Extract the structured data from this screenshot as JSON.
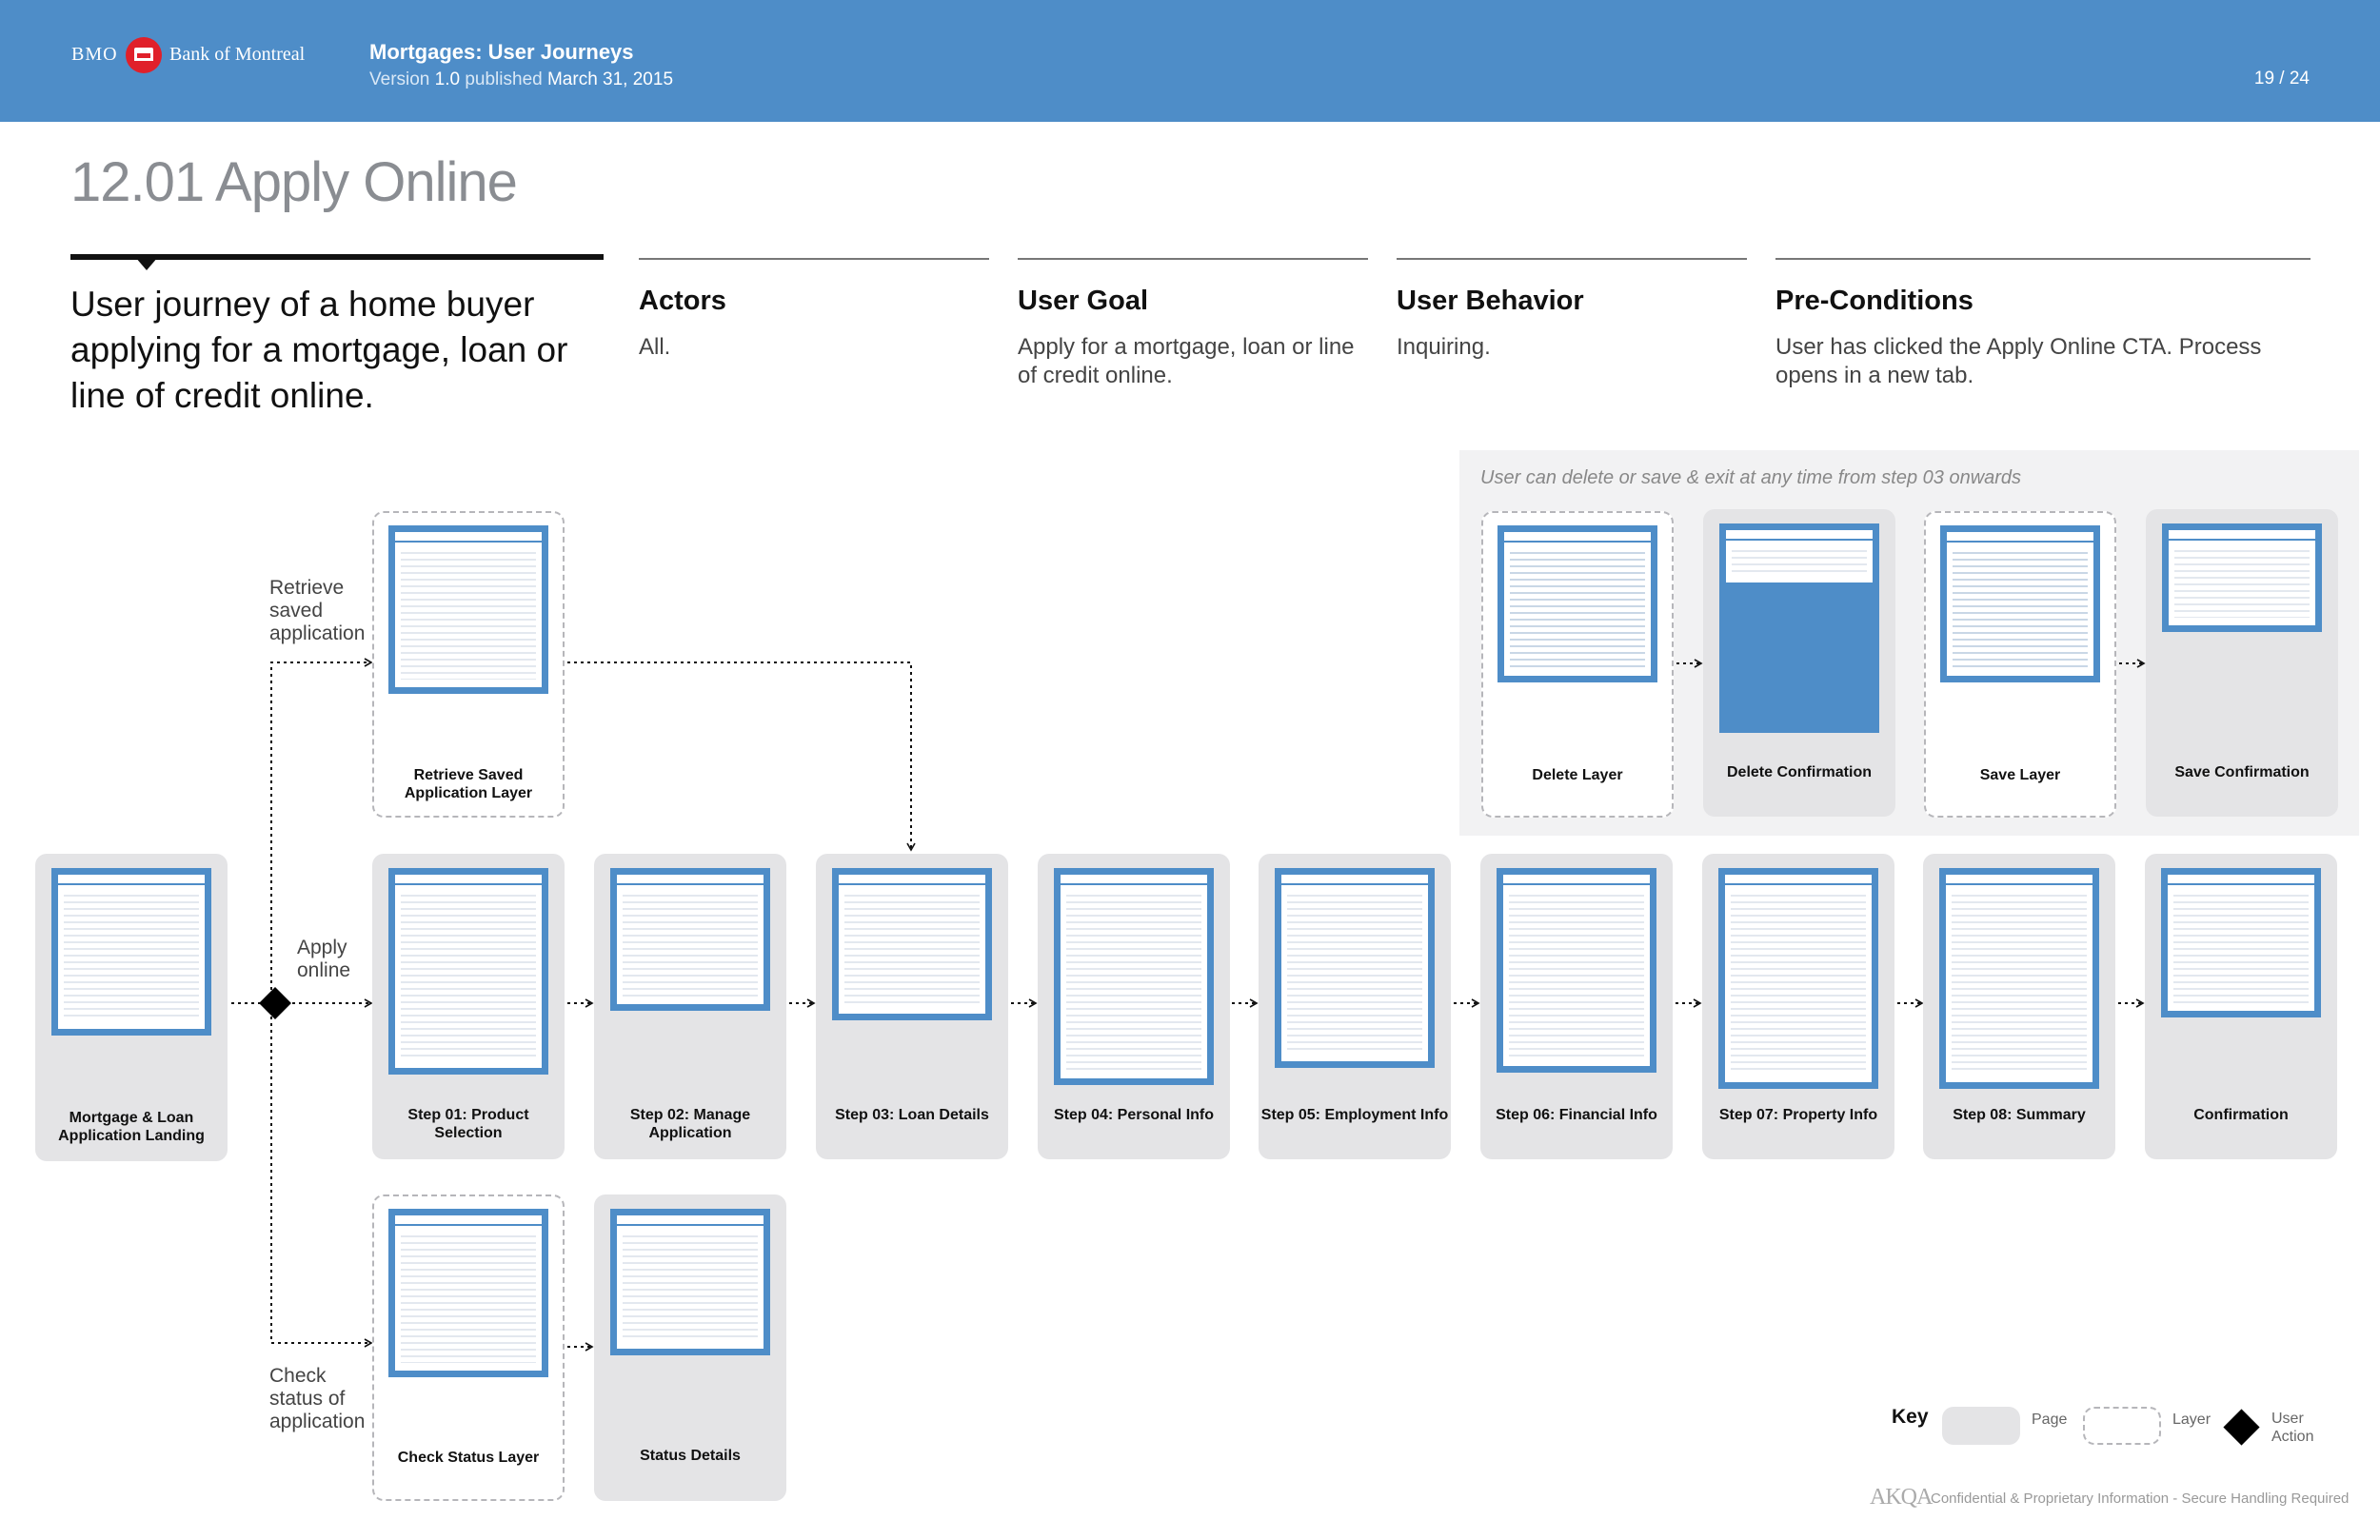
{
  "header": {
    "bank_short": "BMO",
    "bank_name": "Bank of Montreal",
    "doc_title": "Mortgages: User Journeys",
    "version_prefix": "Version",
    "version": "1.0",
    "published_prefix": "published",
    "published_date": "March 31, 2015",
    "page_number": "19",
    "page_separator": "/",
    "page_total": "24"
  },
  "page_title": "12.01 Apply Online",
  "intro": "User journey of a home buyer applying for a mortgage, loan or line of credit online.",
  "columns": [
    {
      "heading": "Actors",
      "body": "All."
    },
    {
      "heading": "User Goal",
      "body": "Apply for a mortgage, loan or line of credit online."
    },
    {
      "heading": "User Behavior",
      "body": "Inquiring."
    },
    {
      "heading": "Pre-Conditions",
      "body": "User has clicked the Apply Online CTA. Process opens in a new tab."
    }
  ],
  "save_panel_note": "User can delete or save & exit at any time from step 03 onwards",
  "branch_labels": {
    "retrieve": "Retrieve saved application",
    "apply": "Apply online",
    "check": "Check status of application"
  },
  "cards": {
    "landing": "Mortgage & Loan Application Landing",
    "retrieve_layer": "Retrieve Saved Application Layer",
    "step01": "Step 01: Product Selection",
    "step02": "Step 02: Manage Application",
    "step03": "Step 03: Loan Details",
    "step04": "Step 04: Personal Info",
    "step05": "Step 05: Employment Info",
    "step06": "Step 06: Financial Info",
    "step07": "Step 07: Property Info",
    "step08": "Step 08: Summary",
    "confirmation": "Confirmation",
    "check_status_layer": "Check Status Layer",
    "status_details": "Status Details",
    "delete_layer": "Delete Layer",
    "delete_confirmation": "Delete Confirmation",
    "save_layer": "Save Layer",
    "save_confirmation": "Save Confirmation"
  },
  "key": {
    "title": "Key",
    "page": "Page",
    "layer": "Layer",
    "user_action": "User Action"
  },
  "footer": {
    "logo": "AKQA",
    "text": "Confidential & Proprietary Information - Secure Handling Required"
  },
  "colors": {
    "header_blue": "#4e8dc8",
    "page_card": "#e4e4e6",
    "accent_red": "#e0202a"
  }
}
